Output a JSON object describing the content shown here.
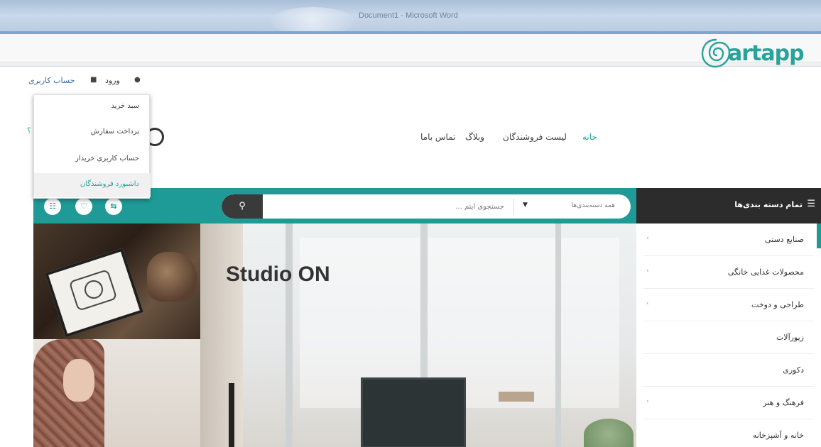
{
  "window": {
    "title": "Document1 - Microsoft Word"
  },
  "topbar": {
    "account_label": "حساب کاربری",
    "login_label": "ورود"
  },
  "logo": {
    "text": "artapp",
    "color": "#28a39a"
  },
  "nav": {
    "home": "خانه",
    "sellers": "لیست فروشندگان",
    "blog": "وبلاگ",
    "contact": "تماس باما"
  },
  "dropdown": {
    "items": [
      "سبد خرید",
      "پرداخت سفارش",
      "حساب کاربری خریدار",
      "داشبورد فروشندگان"
    ],
    "question_mark": "؟"
  },
  "search": {
    "placeholder": "جستجوی آیتم ...",
    "category_label": "همه دسته‌بندی‌ها",
    "button_icon": "search-icon"
  },
  "header_icons": [
    "cart-icon",
    "heart-icon",
    "compare-icon"
  ],
  "all_categories": {
    "label": "تمام دسته بندی‌ها",
    "icon": "menu-icon"
  },
  "hero": {
    "title": "Studio ON"
  },
  "categories": [
    {
      "label": "صنایع دستی",
      "has_children": true
    },
    {
      "label": "محصولات غذایی خانگی",
      "has_children": true
    },
    {
      "label": "طراحی و دوخت",
      "has_children": true
    },
    {
      "label": "زیورآلات",
      "has_children": false
    },
    {
      "label": "دکوری",
      "has_children": false
    },
    {
      "label": "فرهنگ و هنر",
      "has_children": true
    },
    {
      "label": "خانه و آشپزخانه",
      "has_children": false
    }
  ],
  "colors": {
    "teal": "#1e9a97",
    "dark": "#2c2c2c",
    "accent": "#28a39a"
  }
}
